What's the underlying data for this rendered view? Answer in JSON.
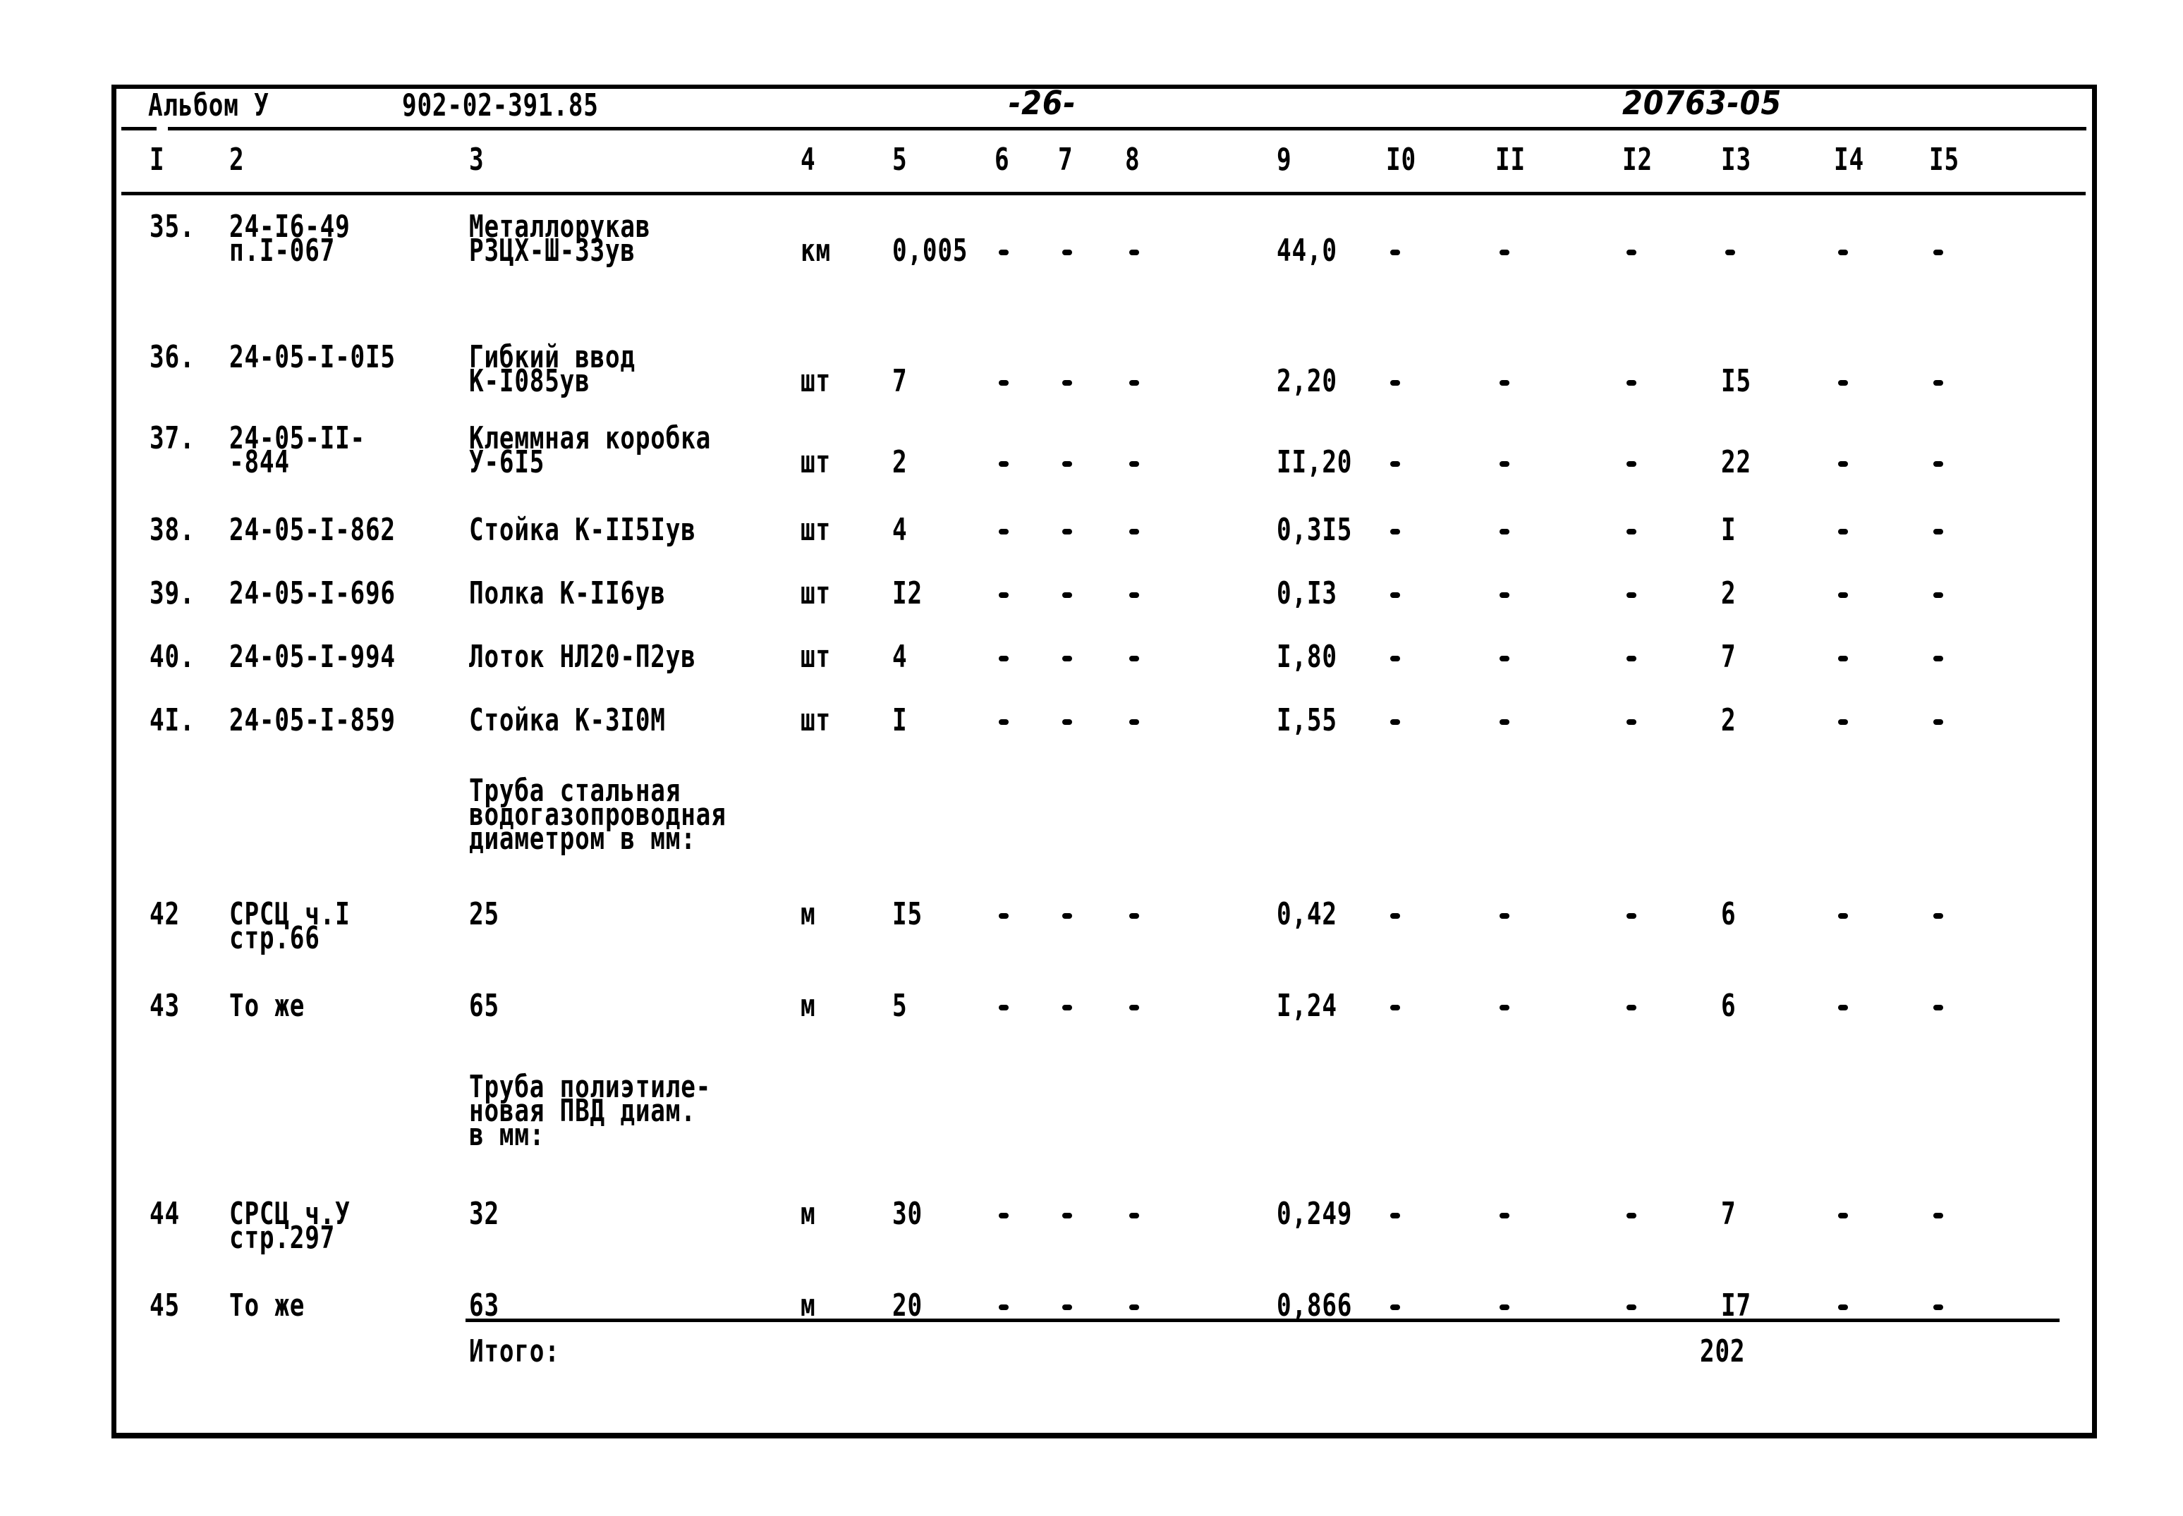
{
  "header": {
    "album": "Альбом У",
    "doc_code": "902-02-391.85",
    "page": "-26-",
    "archive_no": "20763-05"
  },
  "columns": [
    "I",
    "2",
    "3",
    "4",
    "5",
    "6",
    "7",
    "8",
    "9",
    "I0",
    "II",
    "I2",
    "I3",
    "I4",
    "I5"
  ],
  "rows": [
    {
      "no": "35.",
      "code": [
        "24-I6-49",
        "п.I-067"
      ],
      "name": [
        "Металлорукав",
        "РЗЦХ-Ш-33ув"
      ],
      "unit": "км",
      "c5": "0,005",
      "c6": "-",
      "c7": "-",
      "c8": "-",
      "c9": "44,0",
      "c10": "-",
      "c11": "-",
      "c12": "-",
      "c13": "-",
      "c14": "-",
      "c15": "-"
    },
    {
      "no": "36.",
      "code": [
        "24-05-I-0I5"
      ],
      "name": [
        "Гибкий ввод",
        "К-I085ув"
      ],
      "unit": "шт",
      "c5": "7",
      "c6": "-",
      "c7": "-",
      "c8": "-",
      "c9": "2,20",
      "c10": "-",
      "c11": "-",
      "c12": "-",
      "c13": "I5",
      "c14": "-",
      "c15": "-"
    },
    {
      "no": "37.",
      "code": [
        "24-05-II-",
        "-844"
      ],
      "name": [
        "Клеммная коробка",
        "У-6I5"
      ],
      "unit": "шт",
      "c5": "2",
      "c6": "-",
      "c7": "-",
      "c8": "-",
      "c9": "II,20",
      "c10": "-",
      "c11": "-",
      "c12": "-",
      "c13": "22",
      "c14": "-",
      "c15": "-"
    },
    {
      "no": "38.",
      "code": [
        "24-05-I-862"
      ],
      "name": [
        "Стойка К-II5Iув"
      ],
      "unit": "шт",
      "c5": "4",
      "c6": "-",
      "c7": "-",
      "c8": "-",
      "c9": "0,3I5",
      "c10": "-",
      "c11": "-",
      "c12": "-",
      "c13": "I",
      "c14": "-",
      "c15": "-"
    },
    {
      "no": "39.",
      "code": [
        "24-05-I-696"
      ],
      "name": [
        "Полка К-II6ув"
      ],
      "unit": "шт",
      "c5": "I2",
      "c6": "-",
      "c7": "-",
      "c8": "-",
      "c9": "0,I3",
      "c10": "-",
      "c11": "-",
      "c12": "-",
      "c13": "2",
      "c14": "-",
      "c15": "-"
    },
    {
      "no": "40.",
      "code": [
        "24-05-I-994"
      ],
      "name": [
        "Лоток НЛ20-П2ув"
      ],
      "unit": "шт",
      "c5": "4",
      "c6": "-",
      "c7": "-",
      "c8": "-",
      "c9": "I,80",
      "c10": "-",
      "c11": "-",
      "c12": "-",
      "c13": "7",
      "c14": "-",
      "c15": "-"
    },
    {
      "no": "4I.",
      "code": [
        "24-05-I-859"
      ],
      "name": [
        "Стойка К-3I0М"
      ],
      "unit": "шт",
      "c5": "I",
      "c6": "-",
      "c7": "-",
      "c8": "-",
      "c9": "I,55",
      "c10": "-",
      "c11": "-",
      "c12": "-",
      "c13": "2",
      "c14": "-",
      "c15": "-"
    },
    {
      "no": "",
      "code": [],
      "name": [
        "Труба стальная",
        "водогазопроводная",
        "диаметром в мм:"
      ],
      "unit": "",
      "c5": "",
      "c6": "",
      "c7": "",
      "c8": "",
      "c9": "",
      "c10": "",
      "c11": "",
      "c12": "",
      "c13": "",
      "c14": "",
      "c15": ""
    },
    {
      "no": "42",
      "code": [
        "СРСЦ ч.I",
        "стр.66"
      ],
      "name": [
        "25"
      ],
      "unit": "м",
      "c5": "I5",
      "c6": "-",
      "c7": "-",
      "c8": "-",
      "c9": "0,42",
      "c10": "-",
      "c11": "-",
      "c12": "-",
      "c13": "6",
      "c14": "-",
      "c15": "-"
    },
    {
      "no": "43",
      "code": [
        "То же"
      ],
      "name": [
        "65"
      ],
      "unit": "м",
      "c5": "5",
      "c6": "-",
      "c7": "-",
      "c8": "-",
      "c9": "I,24",
      "c10": "-",
      "c11": "-",
      "c12": "-",
      "c13": "6",
      "c14": "-",
      "c15": "-"
    },
    {
      "no": "",
      "code": [],
      "name": [
        "Труба полиэтиле-",
        "новая ПВД диам.",
        "в мм:"
      ],
      "unit": "",
      "c5": "",
      "c6": "",
      "c7": "",
      "c8": "",
      "c9": "",
      "c10": "",
      "c11": "",
      "c12": "",
      "c13": "",
      "c14": "",
      "c15": ""
    },
    {
      "no": "44",
      "code": [
        "СРСЦ ч.У",
        "стр.297"
      ],
      "name": [
        "32"
      ],
      "unit": "м",
      "c5": "30",
      "c6": "-",
      "c7": "-",
      "c8": "-",
      "c9": "0,249",
      "c10": "-",
      "c11": "-",
      "c12": "-",
      "c13": "7",
      "c14": "-",
      "c15": "-"
    },
    {
      "no": "45",
      "code": [
        "То же"
      ],
      "name": [
        "63"
      ],
      "unit": "м",
      "c5": "20",
      "c6": "-",
      "c7": "-",
      "c8": "-",
      "c9": "0,866",
      "c10": "-",
      "c11": "-",
      "c12": "-",
      "c13": "I7",
      "c14": "-",
      "c15": "-"
    }
  ],
  "total": {
    "label": "Итого:",
    "c13": "202"
  }
}
